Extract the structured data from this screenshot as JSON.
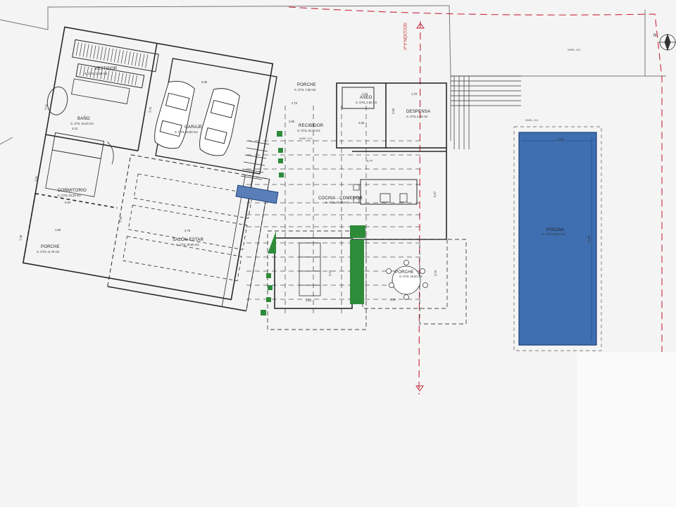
{
  "section_label": "SECCIÓN A-A'",
  "colors": {
    "wall": "#2a2a2a",
    "dashed": "#555555",
    "pool": "#3f6fb0",
    "pool_edge": "#1d3f7a",
    "planter": "#2e8b3a",
    "section": "#c8283c",
    "background": "#f4f4f4"
  },
  "rooms": {
    "vestidor": {
      "name": "VESTIDOR",
      "area": "S. ÚTIL 11,50 m2"
    },
    "bano": {
      "name": "BAÑO",
      "area": "S. ÚTIL 16,40 m2"
    },
    "dormitorio": {
      "name": "DORMITORIO",
      "area": "S. ÚTIL 19,38 m2"
    },
    "porche_w": {
      "name": "PORCHE",
      "area": "S. ÚTIL 11,75 m2"
    },
    "garaje": {
      "name": "GARAJE",
      "area": "S. ÚTIL 34,90 m2"
    },
    "salon": {
      "name": "SALÓN-ESTAR",
      "area": "S. ÚTIL 30,90 m2"
    },
    "porche_n": {
      "name": "PORCHE",
      "area": "S. ÚTIL 7,50 m2"
    },
    "recibidor": {
      "name": "RECIBIDOR",
      "area": "S. ÚTIL 10,70 m2"
    },
    "aseo": {
      "name": "ASEO",
      "area": "S. ÚTIL 2,52 m2"
    },
    "despensa": {
      "name": "DESPENSA",
      "area": "S. ÚTIL 6,30 m2"
    },
    "cocina": {
      "name": "COCINA - COMEDOR",
      "area": "S. ÚTIL 40,14 m2"
    },
    "porche_s": {
      "name": "PORCHE",
      "area": "S. ÚTIL 18,00 m2"
    },
    "piscina": {
      "name": "PISCINA",
      "area": "S. ÚTIL 56,00 m2"
    }
  },
  "levels": {
    "nivel_pool_top": "NIVEL +0,0",
    "nivel_terrace": "NIVEL +0,0",
    "nivel_recibidor": "NIVEL +0,0"
  },
  "dimensions": {
    "d_585": "5,85",
    "d_575": "5,75",
    "d_541": "5,41",
    "d_413": "4,13",
    "d_381": "3,81",
    "d_584": "5,84",
    "d_189": "1,89",
    "d_239": "2,39",
    "d_476": "4,76",
    "d_350": "3,50",
    "d_215": "2,15",
    "d_170": "1,70",
    "d_255": "2,55",
    "d_265": "2,65",
    "d_277": "2,77",
    "d_567": "5,67",
    "d_323": "3,23",
    "d_363": "3,63",
    "d_430": "4,30",
    "d_370": "3,70",
    "d_525": "5,25",
    "d_1050": "10,50",
    "d_470": "4,70",
    "d_286": "2,86"
  },
  "north": "N"
}
